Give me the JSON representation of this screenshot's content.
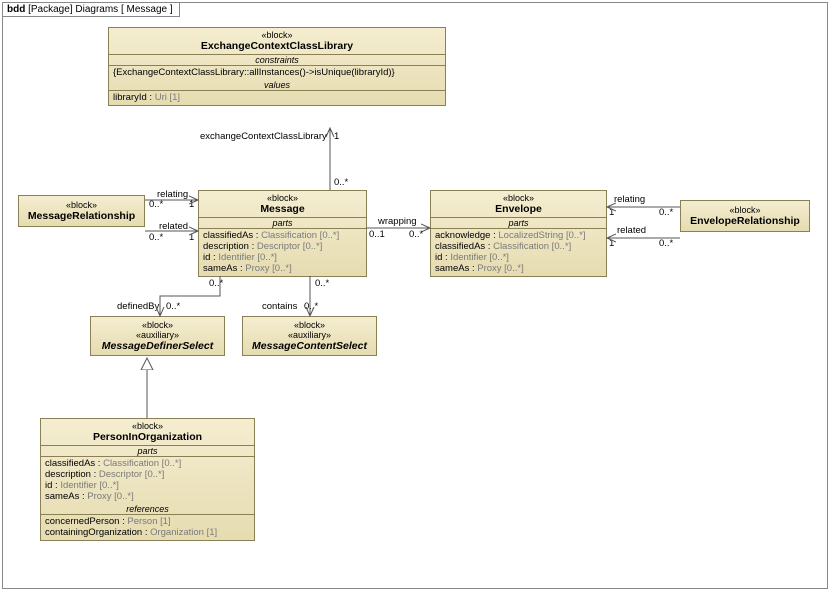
{
  "frame": {
    "kw": "bdd",
    "pkg": "[Package]",
    "diag": "Diagrams",
    "name": "[ Message ]"
  },
  "blocks": {
    "ecl": {
      "st": "«block»",
      "nm": "ExchangeContextClassLibrary",
      "csec": "constraints",
      "c1": "{ExchangeContextClassLibrary::allInstances()->isUnique(libraryId)}",
      "vsec": "values",
      "v1k": "libraryId : ",
      "v1t": "Uri [1]"
    },
    "mrel": {
      "st": "«block»",
      "nm": "MessageRelationship"
    },
    "msg": {
      "st": "«block»",
      "nm": "Message",
      "psec": "parts",
      "p1k": "classifiedAs : ",
      "p1t": "Classification [0..*]",
      "p2k": "description : ",
      "p2t": "Descriptor [0..*]",
      "p3k": "id : ",
      "p3t": "Identifier [0..*]",
      "p4k": "sameAs : ",
      "p4t": "Proxy [0..*]"
    },
    "env": {
      "st": "«block»",
      "nm": "Envelope",
      "psec": "parts",
      "p1k": "acknowledge : ",
      "p1t": "LocalizedString [0..*]",
      "p2k": "classifiedAs : ",
      "p2t": "Classification [0..*]",
      "p3k": "id : ",
      "p3t": "Identifier [0..*]",
      "p4k": "sameAs : ",
      "p4t": "Proxy [0..*]"
    },
    "erel": {
      "st": "«block»",
      "nm": "EnvelopeRelationship"
    },
    "mds": {
      "st1": "«block»",
      "st2": "«auxiliary»",
      "nm": "MessageDefinerSelect"
    },
    "mcs": {
      "st1": "«block»",
      "st2": "«auxiliary»",
      "nm": "MessageContentSelect"
    },
    "pio": {
      "st": "«block»",
      "nm": "PersonInOrganization",
      "psec": "parts",
      "p1k": "classifiedAs : ",
      "p1t": "Classification [0..*]",
      "p2k": "description : ",
      "p2t": "Descriptor [0..*]",
      "p3k": "id : ",
      "p3t": "Identifier [0..*]",
      "p4k": "sameAs : ",
      "p4t": "Proxy [0..*]",
      "rsec": "references",
      "r1k": "concernedPerson : ",
      "r1t": "Person [1]",
      "r2k": "containingOrganization : ",
      "r2t": "Organization [1]"
    }
  },
  "labels": {
    "eclrole": "exchangeContextClassLibrary",
    "m1": "1",
    "m0s": "0..*",
    "m01": "0..1",
    "relating": "relating",
    "related": "related",
    "wrapping": "wrapping",
    "definedBy": "definedBy",
    "contains": "contains"
  }
}
